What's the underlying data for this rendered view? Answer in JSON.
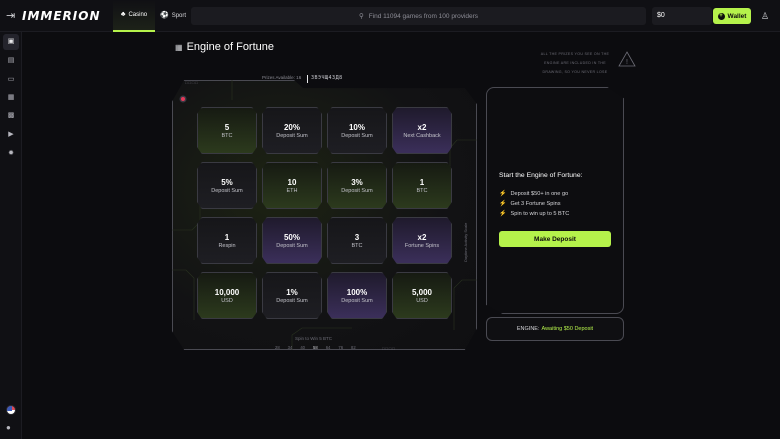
{
  "header": {
    "logo": "IMMERION",
    "tabs": [
      {
        "label": "Casino",
        "icon": "casino-icon",
        "active": true
      },
      {
        "label": "Sport",
        "icon": "sport-icon",
        "active": false
      }
    ],
    "search_placeholder": "Find 11094 games from 100 providers",
    "balance": "$0",
    "wallet_label": "Wallet"
  },
  "sidebar": {
    "items": [
      {
        "icon": "gift-icon",
        "active": true
      },
      {
        "icon": "cards-icon",
        "active": false
      },
      {
        "icon": "game-controller-icon",
        "active": false
      },
      {
        "icon": "grid-icon",
        "active": false
      },
      {
        "icon": "dice-icon",
        "active": false
      },
      {
        "icon": "live-icon",
        "active": false
      },
      {
        "icon": "cog-icon",
        "active": false
      }
    ]
  },
  "page": {
    "title": "Engine of Fortune",
    "warning": "ALL THE PRIZES YOU SEE ON THE ENGINE ARE INCLUDED IN THE DRAWING, SO YOU NEVER LOSE"
  },
  "board": {
    "prizes_label": "Prizes Available: 16",
    "code": "ЗВЭЧЩ4ЗД8",
    "side_label": "Daytime Activity Scale",
    "spin_label": "Spin to Win 5 BTC",
    "spin_numbers": [
      "28",
      "34",
      "40",
      "58",
      "64",
      "76",
      "82"
    ],
    "spin_current_index": 3,
    "cells": [
      {
        "value": "5",
        "label": "BTC",
        "style": "green"
      },
      {
        "value": "20%",
        "label": "Deposit Sum",
        "style": "dark"
      },
      {
        "value": "10%",
        "label": "Deposit Sum",
        "style": "dark"
      },
      {
        "value": "x2",
        "label": "Next Cashback",
        "style": "purple"
      },
      {
        "value": "5%",
        "label": "Deposit Sum",
        "style": "dark"
      },
      {
        "value": "10",
        "label": "ETH",
        "style": "green"
      },
      {
        "value": "3%",
        "label": "Deposit Sum",
        "style": "green"
      },
      {
        "value": "1",
        "label": "BTC",
        "style": "green"
      },
      {
        "value": "1",
        "label": "Respin",
        "style": "dark"
      },
      {
        "value": "50%",
        "label": "Deposit Sum",
        "style": "purple"
      },
      {
        "value": "3",
        "label": "BTC",
        "style": "dark"
      },
      {
        "value": "x2",
        "label": "Fortune Spins",
        "style": "purple"
      },
      {
        "value": "10,000",
        "label": "USD",
        "style": "green"
      },
      {
        "value": "1%",
        "label": "Deposit Sum",
        "style": "dark"
      },
      {
        "value": "100%",
        "label": "Deposit Sum",
        "style": "purple"
      },
      {
        "value": "5,000",
        "label": "USD",
        "style": "green"
      }
    ]
  },
  "info": {
    "title": "Start the Engine of Fortune:",
    "steps": [
      "Deposit $50+ in one go",
      "Get 3 Fortune Spins",
      "Spin to win up to 5 BTC"
    ],
    "button": "Make Deposit",
    "status_label": "ENGINE:",
    "status_value": "Awaiting $50 Deposit"
  },
  "colors": {
    "accent": "#b5f24b",
    "purple": "#3b2f5a",
    "background": "#0c0c0f"
  }
}
